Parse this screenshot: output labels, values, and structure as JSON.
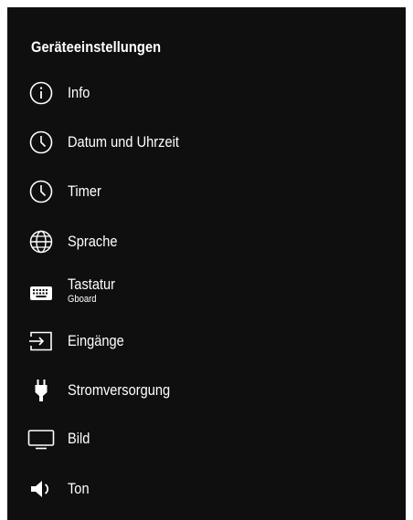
{
  "header": {
    "title": "Geräteeinstellungen"
  },
  "menu": {
    "items": [
      {
        "label": "Info",
        "icon": "info-icon"
      },
      {
        "label": "Datum und Uhrzeit",
        "icon": "clock-icon"
      },
      {
        "label": "Timer",
        "icon": "clock-icon"
      },
      {
        "label": "Sprache",
        "icon": "globe-icon"
      },
      {
        "label": "Tastatur",
        "sublabel": "Gboard",
        "icon": "keyboard-icon"
      },
      {
        "label": "Eingänge",
        "icon": "input-icon"
      },
      {
        "label": "Stromversorgung",
        "icon": "power-plug-icon"
      },
      {
        "label": "Bild",
        "icon": "display-icon"
      },
      {
        "label": "Ton",
        "icon": "speaker-icon"
      }
    ]
  },
  "colors": {
    "background": "#0f0f0f",
    "text": "#ffffff",
    "page": "#ffffff"
  }
}
